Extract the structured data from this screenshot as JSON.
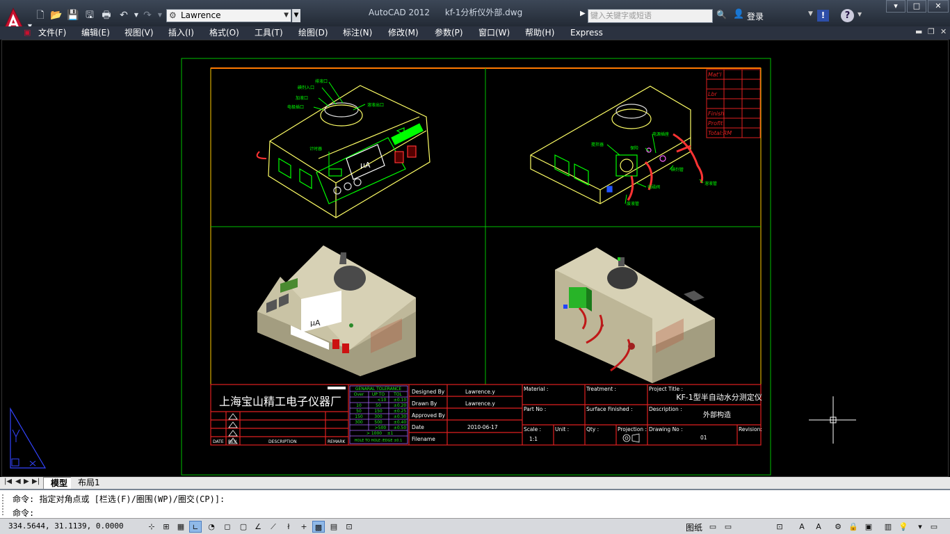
{
  "window": {
    "app_name": "AutoCAD 2012",
    "file_name": "kf-1分析仪外部.dwg",
    "workspace": "Lawrence",
    "search_placeholder": "键入关键字或短语",
    "login": "登录"
  },
  "menu": [
    "文件(F)",
    "编辑(E)",
    "视图(V)",
    "插入(I)",
    "格式(O)",
    "工具(T)",
    "绘图(D)",
    "标注(N)",
    "修改(M)",
    "参数(P)",
    "窗口(W)",
    "帮助(H)",
    "Express"
  ],
  "drawing": {
    "company": "上海宝山精工电子仪器厂",
    "tolerance_title": "GENARAL TOLERANCE",
    "tolerance_headers": [
      "Over",
      "UP TO",
      "TOL"
    ],
    "tolerance_rows": [
      [
        "",
        "<10",
        "±0.10"
      ],
      [
        "10",
        "50",
        "±0.20"
      ],
      [
        "50",
        "150",
        "±0.25"
      ],
      [
        "150",
        "300",
        "±0.30"
      ],
      [
        "300",
        "500",
        "±0.40"
      ],
      [
        "",
        ">500",
        "±0.50"
      ],
      [
        "",
        "> 1000",
        "±1"
      ]
    ],
    "tolerance_note": "HOLE TO HOLE /EDGE ±0.1",
    "designed_by_label": "Designed By",
    "designed_by": "Lawrence.y",
    "drawn_by_label": "Drawn By",
    "drawn_by": "Lawrence.y",
    "approved_by_label": "Approved By",
    "date_label": "Date",
    "date": "2010-06-17",
    "filename_label": "Filename",
    "material_label": "Material :",
    "treatment_label": "Treatment :",
    "project_title_label": "Project Title :",
    "project_title": "KF-1型半自动水分测定仪",
    "part_no_label": "Part No :",
    "surface_label": "Surface Finished :",
    "description_label": "Description :",
    "description": "外部构造",
    "scale_label": "Scale :",
    "scale": "1:1",
    "unit_label": "Unit :",
    "qty_label": "Qty :",
    "projection_label": "Projection :",
    "drawing_no_label": "Drawing No :",
    "drawing_no": "01",
    "revision_label": "Revision:",
    "rev_headers": [
      "DATE",
      "REV.",
      "DESCRIPTION",
      "REMARK"
    ],
    "corner_rows": [
      "Mat'l",
      "Lbr",
      "Finish",
      "Profit",
      "Total:RM"
    ],
    "micro_label": "μA",
    "callouts_left": [
      "排液口",
      "碘剂入口",
      "加液口",
      "溶液出口",
      "电极插口",
      "计时器"
    ],
    "callouts_right": [
      "搅拌器",
      "电源插座",
      "保险",
      "碘剂管",
      "溶液管",
      "电磁阀",
      "废液管"
    ]
  },
  "tabs": {
    "model": "模型",
    "layout": "布局1"
  },
  "command": {
    "history": "命令: 指定对角点或 [栏选(F)/圈围(WP)/圈交(CP)]:",
    "prompt": "命令:"
  },
  "status": {
    "coords": "334.5644, 31.1139, 0.0000",
    "paper": "图纸"
  }
}
